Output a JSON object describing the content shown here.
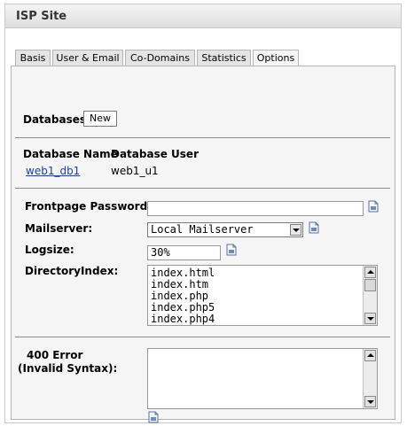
{
  "window": {
    "title": "ISP Site"
  },
  "tabs": [
    "Basis",
    "User & Email",
    "Co-Domains",
    "Statistics",
    "Options"
  ],
  "databases": {
    "label": "Databases",
    "new_button": "New",
    "col_name": "Database Name",
    "col_user": "Database User",
    "rows": [
      {
        "name": "web1_db1",
        "user": "web1_u1"
      }
    ]
  },
  "form": {
    "frontpage_label": "Frontpage Password:",
    "frontpage_value": "",
    "mailserver_label": "Mailserver:",
    "mailserver_value": "Local Mailserver",
    "logsize_label": "Logsize:",
    "logsize_value": "30%",
    "dirindex_label": "DirectoryIndex:",
    "dirindex_lines": [
      "index.html",
      "index.htm",
      "index.php",
      "index.php5",
      "index.php4"
    ],
    "error400_label_1": "400 Error",
    "error400_label_2": "(Invalid Syntax):",
    "error400_value": ""
  }
}
